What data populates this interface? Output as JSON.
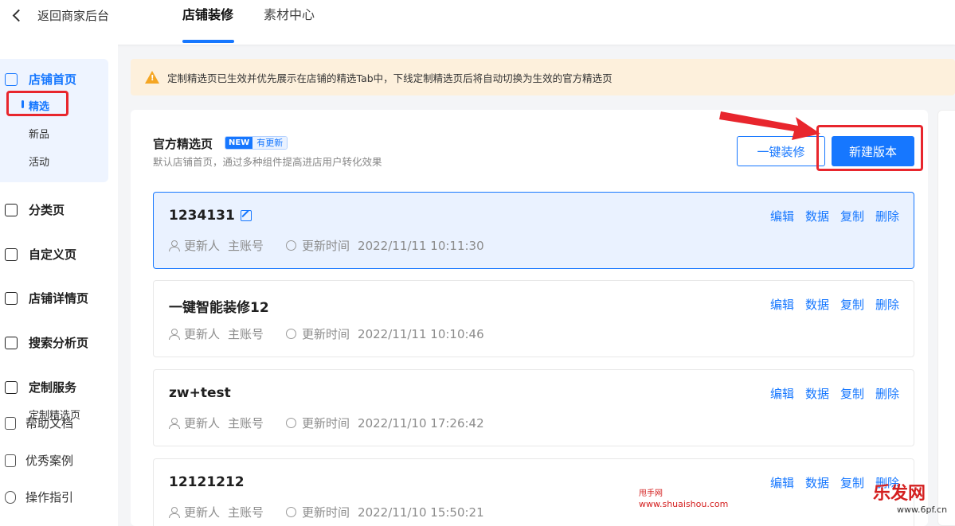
{
  "header": {
    "back_label": "返回商家后台",
    "tabs": [
      {
        "label": "店铺装修",
        "active": true
      },
      {
        "label": "素材中心",
        "active": false
      }
    ],
    "accent_color": "#1677ff"
  },
  "sidebar": {
    "home": {
      "label": "店铺首页",
      "subitems": [
        "精选",
        "新品",
        "活动"
      ],
      "selected": "精选"
    },
    "items": [
      "分类页",
      "自定义页",
      "店铺详情页",
      "搜索分析页",
      "定制服务"
    ],
    "custom_sub": "定制精选页",
    "help": [
      "帮助文档",
      "优秀案例",
      "操作指引"
    ]
  },
  "banner": {
    "text": "定制精选页已生效并优先展示在店铺的精选Tab中，下线定制精选页后将自动切换为生效的官方精选页"
  },
  "section": {
    "title": "官方精选页",
    "badge_new": "NEW",
    "badge_update": "有更新",
    "description": "默认店铺首页，通过多种组件提高进店用户转化效果",
    "btn_one_click": "一键装修",
    "btn_new_version": "新建版本"
  },
  "meta_labels": {
    "updater": "更新人",
    "update_time": "更新时间"
  },
  "action_labels": [
    "编辑",
    "数据",
    "复制",
    "删除"
  ],
  "versions": [
    {
      "name": "1234131",
      "updater": "主账号",
      "time": "2022/11/11 10:11:30",
      "active": true
    },
    {
      "name": "一键智能装修12",
      "updater": "主账号",
      "time": "2022/11/11 10:10:46",
      "active": false
    },
    {
      "name": "zw+test",
      "updater": "主账号",
      "time": "2022/11/10 17:26:42",
      "active": false
    },
    {
      "name": "12121212",
      "updater": "主账号",
      "time": "2022/11/10 15:50:21",
      "active": false
    }
  ],
  "watermark": {
    "line1": "甩手网",
    "line2": "www.shuaishou.com",
    "brand": "乐发网",
    "brand_url": "www.6pf.cn"
  },
  "annotation_color": "#e8262d"
}
